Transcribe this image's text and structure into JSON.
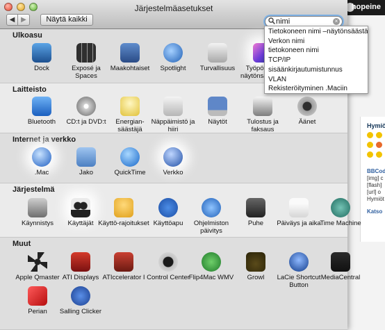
{
  "window": {
    "title": "Järjestelmäasetukset",
    "back_symbol": "◀",
    "forward_symbol": "▶",
    "show_all_label": "Näytä kaikki"
  },
  "search": {
    "value": "nimi",
    "clear_symbol": "×"
  },
  "suggestions": [
    "Tietokoneen nimi –näytönsäästäjä",
    "Verkon nimi",
    "tietokoneen nimi",
    "TCP/IP",
    "sisäänkirjautumistunnus",
    "VLAN",
    "Rekisteröityminen .Maciin"
  ],
  "sections": [
    {
      "title": "Ulkoasu",
      "items": [
        {
          "label": "Dock",
          "icon": "dock-icon",
          "highlighted": false
        },
        {
          "label": "Exposé ja Spaces",
          "icon": "expose-spaces-icon",
          "highlighted": false
        },
        {
          "label": "Maakohtaiset",
          "icon": "international-icon",
          "highlighted": false
        },
        {
          "label": "Spotlight",
          "icon": "spotlight-icon",
          "highlighted": false
        },
        {
          "label": "Turvallisuus",
          "icon": "security-house-icon",
          "highlighted": false
        },
        {
          "label": "Työpöytä ja näytönsäästäjä",
          "icon": "desktop-screensaver-icon",
          "highlighted": true
        }
      ]
    },
    {
      "title": "Laitteisto",
      "items": [
        {
          "label": "Bluetooth",
          "icon": "bluetooth-icon",
          "highlighted": false
        },
        {
          "label": "CD:t ja DVD:t",
          "icon": "cd-dvd-icon",
          "highlighted": false
        },
        {
          "label": "Energian-säästäjä",
          "icon": "energy-saver-icon",
          "highlighted": false
        },
        {
          "label": "Näppäimistö ja hiiri",
          "icon": "keyboard-mouse-icon",
          "highlighted": false
        },
        {
          "label": "Näytöt",
          "icon": "displays-icon",
          "highlighted": false
        },
        {
          "label": "Tulostus ja faksaus",
          "icon": "print-fax-icon",
          "highlighted": false
        },
        {
          "label": "Äänet",
          "icon": "sound-icon",
          "highlighted": false
        }
      ]
    },
    {
      "title": "Internet ja verkko",
      "items": [
        {
          "label": ".Mac",
          "icon": "dotmac-icon",
          "highlighted": true
        },
        {
          "label": "Jako",
          "icon": "sharing-icon",
          "highlighted": false
        },
        {
          "label": "QuickTime",
          "icon": "quicktime-icon",
          "highlighted": false
        },
        {
          "label": "Verkko",
          "icon": "network-icon",
          "highlighted": true
        }
      ]
    },
    {
      "title": "Järjestelmä",
      "items": [
        {
          "label": "Käynnistys",
          "icon": "startup-disk-icon",
          "highlighted": false
        },
        {
          "label": "Käyttäjät",
          "icon": "accounts-icon",
          "highlighted": true
        },
        {
          "label": "Käyttö-rajoitukset",
          "icon": "parental-controls-icon",
          "highlighted": false
        },
        {
          "label": "Käyttöapu",
          "icon": "universal-access-icon",
          "highlighted": false
        },
        {
          "label": "Ohjelmiston päivitys",
          "icon": "software-update-icon",
          "highlighted": false
        },
        {
          "label": "Puhe",
          "icon": "speech-icon",
          "highlighted": false
        },
        {
          "label": "Päiväys ja aika",
          "icon": "date-time-icon",
          "highlighted": false
        },
        {
          "label": "Time Machine",
          "icon": "time-machine-icon",
          "highlighted": false
        }
      ]
    },
    {
      "title": "Muut",
      "items": [
        {
          "label": "Apple Qmaster",
          "icon": "qmaster-icon",
          "highlighted": false
        },
        {
          "label": "ATI Displays",
          "icon": "ati-displays-icon",
          "highlighted": false
        },
        {
          "label": "ATIccelerator I",
          "icon": "aticcelerator-icon",
          "highlighted": false
        },
        {
          "label": "Control Center",
          "icon": "logitech-control-center-icon",
          "highlighted": false
        },
        {
          "label": "Flip4Mac WMV",
          "icon": "flip4mac-icon",
          "highlighted": false
        },
        {
          "label": "Growl",
          "icon": "growl-icon",
          "highlighted": false
        },
        {
          "label": "LaCie Shortcut Button",
          "icon": "lacie-icon",
          "highlighted": false
        },
        {
          "label": "MediaCentral",
          "icon": "mediacentral-icon",
          "highlighted": false
        },
        {
          "label": "Perian",
          "icon": "perian-icon",
          "highlighted": false
        },
        {
          "label": "Salling Clicker",
          "icon": "salling-clicker-icon",
          "highlighted": false
        }
      ]
    }
  ],
  "background_page": {
    "user": "hopeine",
    "side_title": "Hymiö",
    "side_links": [
      "BBCod",
      "[img] c",
      "[flash]",
      "[url] o",
      "Hymiöt"
    ],
    "katso": "Katso"
  },
  "colors": {
    "search_focus": "#7fb2e6",
    "dim_overlay": "rgba(0,0,0,0.18)"
  }
}
